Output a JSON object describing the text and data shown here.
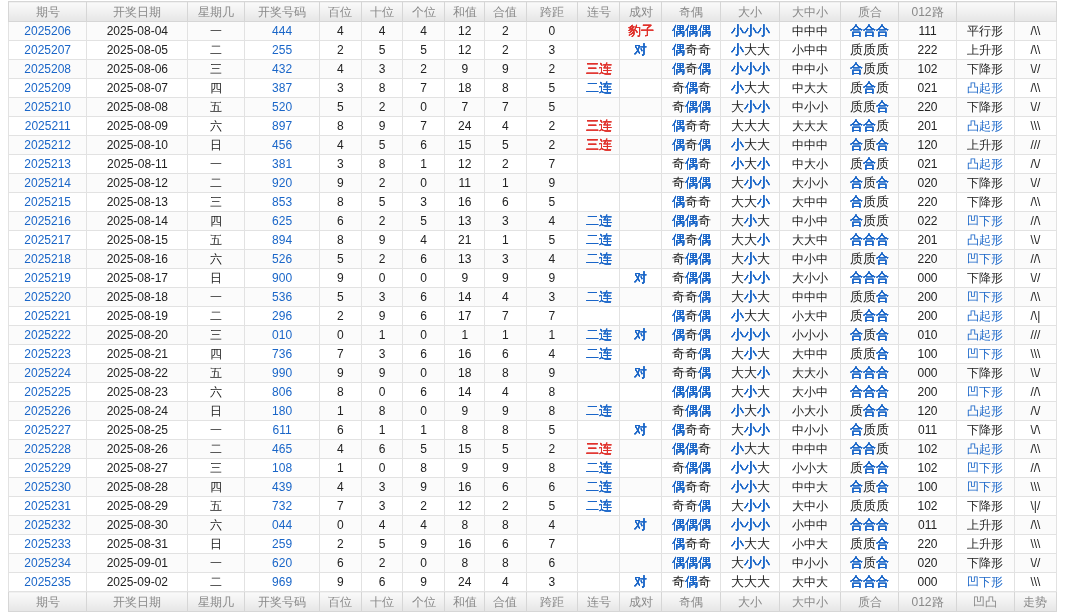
{
  "header_top": [
    "期号",
    "开奖日期",
    "星期几",
    "开奖号码",
    "百位",
    "十位",
    "个位",
    "和值",
    "合值",
    "跨距",
    "连号",
    "成对",
    "奇偶",
    "大小",
    "大中小",
    "质合",
    "012路"
  ],
  "rows": [
    {
      "issue": "2025206",
      "date": "2025-08-04",
      "weekday": "一",
      "number": "444",
      "hundreds": "4",
      "tens": "4",
      "units": "4",
      "sum": "12",
      "sum_tail": "2",
      "span": "0",
      "pair": {
        "text": "豹子",
        "color": "#e0302a"
      },
      "odd_even": "偶偶偶",
      "odd_even_blue": [
        true,
        true,
        true
      ],
      "big_small": "小小小",
      "big_small_blue": [
        true,
        true,
        true
      ],
      "big_mid_small": "中中中",
      "prime_composite": "合合合",
      "prime_composite_blue": [
        true,
        true,
        true
      ],
      "road_012": "111",
      "shape": "平行形",
      "shape_blue": false,
      "trend": "/\\\\"
    },
    {
      "issue": "2025207",
      "date": "2025-08-05",
      "weekday": "二",
      "number": "255",
      "hundreds": "2",
      "tens": "5",
      "units": "5",
      "sum": "12",
      "sum_tail": "2",
      "span": "3",
      "pair": {
        "text": "对",
        "color": "#1a66c8"
      },
      "odd_even": "偶奇奇",
      "odd_even_blue": [
        true,
        false,
        false
      ],
      "big_small": "小大大",
      "big_small_blue": [
        true,
        false,
        false
      ],
      "big_mid_small": "小中中",
      "prime_composite": "质质质",
      "prime_composite_blue": [
        false,
        false,
        false
      ],
      "road_012": "222",
      "shape": "上升形",
      "shape_blue": false,
      "trend": "/\\\\"
    },
    {
      "issue": "2025208",
      "date": "2025-08-06",
      "weekday": "三",
      "number": "432",
      "hundreds": "4",
      "tens": "3",
      "units": "2",
      "sum": "9",
      "sum_tail": "9",
      "span": "2",
      "consecutive": {
        "text": "三连",
        "color": "#e0302a"
      },
      "odd_even": "偶奇偶",
      "odd_even_blue": [
        true,
        false,
        true
      ],
      "big_small": "小小小",
      "big_small_blue": [
        true,
        true,
        true
      ],
      "big_mid_small": "中中小",
      "prime_composite": "合质质",
      "prime_composite_blue": [
        true,
        false,
        false
      ],
      "road_012": "102",
      "shape": "下降形",
      "shape_blue": false,
      "trend": "\\//"
    },
    {
      "issue": "2025209",
      "date": "2025-08-07",
      "weekday": "四",
      "number": "387",
      "hundreds": "3",
      "tens": "8",
      "units": "7",
      "sum": "18",
      "sum_tail": "8",
      "span": "5",
      "consecutive": {
        "text": "二连",
        "color": "#1a66c8"
      },
      "odd_even": "奇偶奇",
      "odd_even_blue": [
        false,
        true,
        false
      ],
      "big_small": "小大大",
      "big_small_blue": [
        true,
        false,
        false
      ],
      "big_mid_small": "中大大",
      "prime_composite": "质合质",
      "prime_composite_blue": [
        false,
        true,
        false
      ],
      "road_012": "021",
      "shape": "凸起形",
      "shape_blue": true,
      "trend": "/\\\\"
    },
    {
      "issue": "2025210",
      "date": "2025-08-08",
      "weekday": "五",
      "number": "520",
      "hundreds": "5",
      "tens": "2",
      "units": "0",
      "sum": "7",
      "sum_tail": "7",
      "span": "5",
      "odd_even": "奇偶偶",
      "odd_even_blue": [
        false,
        true,
        true
      ],
      "big_small": "大小小",
      "big_small_blue": [
        false,
        true,
        true
      ],
      "big_mid_small": "中小小",
      "prime_composite": "质质合",
      "prime_composite_blue": [
        false,
        false,
        true
      ],
      "road_012": "220",
      "shape": "下降形",
      "shape_blue": false,
      "trend": "\\//"
    },
    {
      "issue": "2025211",
      "date": "2025-08-09",
      "weekday": "六",
      "number": "897",
      "hundreds": "8",
      "tens": "9",
      "units": "7",
      "sum": "24",
      "sum_tail": "4",
      "span": "2",
      "consecutive": {
        "text": "三连",
        "color": "#e0302a"
      },
      "odd_even": "偶奇奇",
      "odd_even_blue": [
        true,
        false,
        false
      ],
      "big_small": "大大大",
      "big_small_blue": [
        false,
        false,
        false
      ],
      "big_mid_small": "大大大",
      "prime_composite": "合合质",
      "prime_composite_blue": [
        true,
        true,
        false
      ],
      "road_012": "201",
      "shape": "凸起形",
      "shape_blue": true,
      "trend": "\\\\\\"
    },
    {
      "issue": "2025212",
      "date": "2025-08-10",
      "weekday": "日",
      "number": "456",
      "hundreds": "4",
      "tens": "5",
      "units": "6",
      "sum": "15",
      "sum_tail": "5",
      "span": "2",
      "consecutive": {
        "text": "三连",
        "color": "#e0302a"
      },
      "odd_even": "偶奇偶",
      "odd_even_blue": [
        true,
        false,
        true
      ],
      "big_small": "小大大",
      "big_small_blue": [
        true,
        false,
        false
      ],
      "big_mid_small": "中中中",
      "prime_composite": "合质合",
      "prime_composite_blue": [
        true,
        false,
        true
      ],
      "road_012": "120",
      "shape": "上升形",
      "shape_blue": false,
      "trend": "///"
    },
    {
      "issue": "2025213",
      "date": "2025-08-11",
      "weekday": "一",
      "number": "381",
      "hundreds": "3",
      "tens": "8",
      "units": "1",
      "sum": "12",
      "sum_tail": "2",
      "span": "7",
      "odd_even": "奇偶奇",
      "odd_even_blue": [
        false,
        true,
        false
      ],
      "big_small": "小大小",
      "big_small_blue": [
        true,
        false,
        true
      ],
      "big_mid_small": "中大小",
      "prime_composite": "质合质",
      "prime_composite_blue": [
        false,
        true,
        false
      ],
      "road_012": "021",
      "shape": "凸起形",
      "shape_blue": true,
      "trend": "/\\/"
    },
    {
      "issue": "2025214",
      "date": "2025-08-12",
      "weekday": "二",
      "number": "920",
      "hundreds": "9",
      "tens": "2",
      "units": "0",
      "sum": "11",
      "sum_tail": "1",
      "span": "9",
      "odd_even": "奇偶偶",
      "odd_even_blue": [
        false,
        true,
        true
      ],
      "big_small": "大小小",
      "big_small_blue": [
        false,
        true,
        true
      ],
      "big_mid_small": "大小小",
      "prime_composite": "合质合",
      "prime_composite_blue": [
        true,
        false,
        true
      ],
      "road_012": "020",
      "shape": "下降形",
      "shape_blue": false,
      "trend": "\\//"
    },
    {
      "issue": "2025215",
      "date": "2025-08-13",
      "weekday": "三",
      "number": "853",
      "hundreds": "8",
      "tens": "5",
      "units": "3",
      "sum": "16",
      "sum_tail": "6",
      "span": "5",
      "odd_even": "偶奇奇",
      "odd_even_blue": [
        true,
        false,
        false
      ],
      "big_small": "大大小",
      "big_small_blue": [
        false,
        false,
        true
      ],
      "big_mid_small": "大中中",
      "prime_composite": "合质质",
      "prime_composite_blue": [
        true,
        false,
        false
      ],
      "road_012": "220",
      "shape": "下降形",
      "shape_blue": false,
      "trend": "/\\\\"
    },
    {
      "issue": "2025216",
      "date": "2025-08-14",
      "weekday": "四",
      "number": "625",
      "hundreds": "6",
      "tens": "2",
      "units": "5",
      "sum": "13",
      "sum_tail": "3",
      "span": "4",
      "consecutive": {
        "text": "二连",
        "color": "#1a66c8"
      },
      "odd_even": "偶偶奇",
      "odd_even_blue": [
        true,
        true,
        false
      ],
      "big_small": "大小大",
      "big_small_blue": [
        false,
        true,
        false
      ],
      "big_mid_small": "中小中",
      "prime_composite": "合质质",
      "prime_composite_blue": [
        true,
        false,
        false
      ],
      "road_012": "022",
      "shape": "凹下形",
      "shape_blue": true,
      "trend": "//\\"
    },
    {
      "issue": "2025217",
      "date": "2025-08-15",
      "weekday": "五",
      "number": "894",
      "hundreds": "8",
      "tens": "9",
      "units": "4",
      "sum": "21",
      "sum_tail": "1",
      "span": "5",
      "consecutive": {
        "text": "二连",
        "color": "#1a66c8"
      },
      "odd_even": "偶奇偶",
      "odd_even_blue": [
        true,
        false,
        true
      ],
      "big_small": "大大小",
      "big_small_blue": [
        false,
        false,
        true
      ],
      "big_mid_small": "大大中",
      "prime_composite": "合合合",
      "prime_composite_blue": [
        true,
        true,
        true
      ],
      "road_012": "201",
      "shape": "凸起形",
      "shape_blue": true,
      "trend": "\\\\/"
    },
    {
      "issue": "2025218",
      "date": "2025-08-16",
      "weekday": "六",
      "number": "526",
      "hundreds": "5",
      "tens": "2",
      "units": "6",
      "sum": "13",
      "sum_tail": "3",
      "span": "4",
      "consecutive": {
        "text": "二连",
        "color": "#1a66c8"
      },
      "odd_even": "奇偶偶",
      "odd_even_blue": [
        false,
        true,
        true
      ],
      "big_small": "大小大",
      "big_small_blue": [
        false,
        true,
        false
      ],
      "big_mid_small": "中小中",
      "prime_composite": "质质合",
      "prime_composite_blue": [
        false,
        false,
        true
      ],
      "road_012": "220",
      "shape": "凹下形",
      "shape_blue": true,
      "trend": "//\\"
    },
    {
      "issue": "2025219",
      "date": "2025-08-17",
      "weekday": "日",
      "number": "900",
      "hundreds": "9",
      "tens": "0",
      "units": "0",
      "sum": "9",
      "sum_tail": "9",
      "span": "9",
      "pair": {
        "text": "对",
        "color": "#1a66c8"
      },
      "odd_even": "奇偶偶",
      "odd_even_blue": [
        false,
        true,
        true
      ],
      "big_small": "大小小",
      "big_small_blue": [
        false,
        true,
        true
      ],
      "big_mid_small": "大小小",
      "prime_composite": "合合合",
      "prime_composite_blue": [
        true,
        true,
        true
      ],
      "road_012": "000",
      "shape": "下降形",
      "shape_blue": false,
      "trend": "\\//"
    },
    {
      "issue": "2025220",
      "date": "2025-08-18",
      "weekday": "一",
      "number": "536",
      "hundreds": "5",
      "tens": "3",
      "units": "6",
      "sum": "14",
      "sum_tail": "4",
      "span": "3",
      "consecutive": {
        "text": "二连",
        "color": "#1a66c8"
      },
      "odd_even": "奇奇偶",
      "odd_even_blue": [
        false,
        false,
        true
      ],
      "big_small": "大小大",
      "big_small_blue": [
        false,
        true,
        false
      ],
      "big_mid_small": "中中中",
      "prime_composite": "质质合",
      "prime_composite_blue": [
        false,
        false,
        true
      ],
      "road_012": "200",
      "shape": "凹下形",
      "shape_blue": true,
      "trend": "/\\\\"
    },
    {
      "issue": "2025221",
      "date": "2025-08-19",
      "weekday": "二",
      "number": "296",
      "hundreds": "2",
      "tens": "9",
      "units": "6",
      "sum": "17",
      "sum_tail": "7",
      "span": "7",
      "odd_even": "偶奇偶",
      "odd_even_blue": [
        true,
        false,
        true
      ],
      "big_small": "小大大",
      "big_small_blue": [
        true,
        false,
        false
      ],
      "big_mid_small": "小大中",
      "prime_composite": "质合合",
      "prime_composite_blue": [
        false,
        true,
        true
      ],
      "road_012": "200",
      "shape": "凸起形",
      "shape_blue": true,
      "trend": "/\\|"
    },
    {
      "issue": "2025222",
      "date": "2025-08-20",
      "weekday": "三",
      "number": "010",
      "hundreds": "0",
      "tens": "1",
      "units": "0",
      "sum": "1",
      "sum_tail": "1",
      "span": "1",
      "consecutive": {
        "text": "二连",
        "color": "#1a66c8"
      },
      "pair": {
        "text": "对",
        "color": "#1a66c8"
      },
      "odd_even": "偶奇偶",
      "odd_even_blue": [
        true,
        false,
        true
      ],
      "big_small": "小小小",
      "big_small_blue": [
        true,
        true,
        true
      ],
      "big_mid_small": "小小小",
      "prime_composite": "合质合",
      "prime_composite_blue": [
        true,
        false,
        true
      ],
      "road_012": "010",
      "shape": "凸起形",
      "shape_blue": true,
      "trend": "///"
    },
    {
      "issue": "2025223",
      "date": "2025-08-21",
      "weekday": "四",
      "number": "736",
      "hundreds": "7",
      "tens": "3",
      "units": "6",
      "sum": "16",
      "sum_tail": "6",
      "span": "4",
      "consecutive": {
        "text": "二连",
        "color": "#1a66c8"
      },
      "odd_even": "奇奇偶",
      "odd_even_blue": [
        false,
        false,
        true
      ],
      "big_small": "大小大",
      "big_small_blue": [
        false,
        true,
        false
      ],
      "big_mid_small": "大中中",
      "prime_composite": "质质合",
      "prime_composite_blue": [
        false,
        false,
        true
      ],
      "road_012": "100",
      "shape": "凹下形",
      "shape_blue": true,
      "trend": "\\\\\\"
    },
    {
      "issue": "2025224",
      "date": "2025-08-22",
      "weekday": "五",
      "number": "990",
      "hundreds": "9",
      "tens": "9",
      "units": "0",
      "sum": "18",
      "sum_tail": "8",
      "span": "9",
      "pair": {
        "text": "对",
        "color": "#1a66c8"
      },
      "odd_even": "奇奇偶",
      "odd_even_blue": [
        false,
        false,
        true
      ],
      "big_small": "大大小",
      "big_small_blue": [
        false,
        false,
        true
      ],
      "big_mid_small": "大大小",
      "prime_composite": "合合合",
      "prime_composite_blue": [
        true,
        true,
        true
      ],
      "road_012": "000",
      "shape": "下降形",
      "shape_blue": false,
      "trend": "\\\\/"
    },
    {
      "issue": "2025225",
      "date": "2025-08-23",
      "weekday": "六",
      "number": "806",
      "hundreds": "8",
      "tens": "0",
      "units": "6",
      "sum": "14",
      "sum_tail": "4",
      "span": "8",
      "odd_even": "偶偶偶",
      "odd_even_blue": [
        true,
        true,
        true
      ],
      "big_small": "大小大",
      "big_small_blue": [
        false,
        true,
        false
      ],
      "big_mid_small": "大小中",
      "prime_composite": "合合合",
      "prime_composite_blue": [
        true,
        true,
        true
      ],
      "road_012": "200",
      "shape": "凹下形",
      "shape_blue": true,
      "trend": "//\\"
    },
    {
      "issue": "2025226",
      "date": "2025-08-24",
      "weekday": "日",
      "number": "180",
      "hundreds": "1",
      "tens": "8",
      "units": "0",
      "sum": "9",
      "sum_tail": "9",
      "span": "8",
      "consecutive": {
        "text": "二连",
        "color": "#1a66c8"
      },
      "odd_even": "奇偶偶",
      "odd_even_blue": [
        false,
        true,
        true
      ],
      "big_small": "小大小",
      "big_small_blue": [
        true,
        false,
        true
      ],
      "big_mid_small": "小大小",
      "prime_composite": "质合合",
      "prime_composite_blue": [
        false,
        true,
        true
      ],
      "road_012": "120",
      "shape": "凸起形",
      "shape_blue": true,
      "trend": "/\\/"
    },
    {
      "issue": "2025227",
      "date": "2025-08-25",
      "weekday": "一",
      "number": "611",
      "hundreds": "6",
      "tens": "1",
      "units": "1",
      "sum": "8",
      "sum_tail": "8",
      "span": "5",
      "pair": {
        "text": "对",
        "color": "#1a66c8"
      },
      "odd_even": "偶奇奇",
      "odd_even_blue": [
        true,
        false,
        false
      ],
      "big_small": "大小小",
      "big_small_blue": [
        false,
        true,
        true
      ],
      "big_mid_small": "中小小",
      "prime_composite": "合质质",
      "prime_composite_blue": [
        true,
        false,
        false
      ],
      "road_012": "011",
      "shape": "下降形",
      "shape_blue": false,
      "trend": "\\/\\"
    },
    {
      "issue": "2025228",
      "date": "2025-08-26",
      "weekday": "二",
      "number": "465",
      "hundreds": "4",
      "tens": "6",
      "units": "5",
      "sum": "15",
      "sum_tail": "5",
      "span": "2",
      "consecutive": {
        "text": "三连",
        "color": "#e0302a"
      },
      "odd_even": "偶偶奇",
      "odd_even_blue": [
        true,
        true,
        false
      ],
      "big_small": "小大大",
      "big_small_blue": [
        true,
        false,
        false
      ],
      "big_mid_small": "中中中",
      "prime_composite": "合合质",
      "prime_composite_blue": [
        true,
        true,
        false
      ],
      "road_012": "102",
      "shape": "凸起形",
      "shape_blue": true,
      "trend": "/\\\\"
    },
    {
      "issue": "2025229",
      "date": "2025-08-27",
      "weekday": "三",
      "number": "108",
      "hundreds": "1",
      "tens": "0",
      "units": "8",
      "sum": "9",
      "sum_tail": "9",
      "span": "8",
      "consecutive": {
        "text": "二连",
        "color": "#1a66c8"
      },
      "odd_even": "奇偶偶",
      "odd_even_blue": [
        false,
        true,
        true
      ],
      "big_small": "小小大",
      "big_small_blue": [
        true,
        true,
        false
      ],
      "big_mid_small": "小小大",
      "prime_composite": "质合合",
      "prime_composite_blue": [
        false,
        true,
        true
      ],
      "road_012": "102",
      "shape": "凹下形",
      "shape_blue": true,
      "trend": "//\\"
    },
    {
      "issue": "2025230",
      "date": "2025-08-28",
      "weekday": "四",
      "number": "439",
      "hundreds": "4",
      "tens": "3",
      "units": "9",
      "sum": "16",
      "sum_tail": "6",
      "span": "6",
      "consecutive": {
        "text": "二连",
        "color": "#1a66c8"
      },
      "odd_even": "偶奇奇",
      "odd_even_blue": [
        true,
        false,
        false
      ],
      "big_small": "小小大",
      "big_small_blue": [
        true,
        true,
        false
      ],
      "big_mid_small": "中中大",
      "prime_composite": "合质合",
      "prime_composite_blue": [
        true,
        false,
        true
      ],
      "road_012": "100",
      "shape": "凹下形",
      "shape_blue": true,
      "trend": "\\\\\\"
    },
    {
      "issue": "2025231",
      "date": "2025-08-29",
      "weekday": "五",
      "number": "732",
      "hundreds": "7",
      "tens": "3",
      "units": "2",
      "sum": "12",
      "sum_tail": "2",
      "span": "5",
      "consecutive": {
        "text": "二连",
        "color": "#1a66c8"
      },
      "odd_even": "奇奇偶",
      "odd_even_blue": [
        false,
        false,
        true
      ],
      "big_small": "大小小",
      "big_small_blue": [
        false,
        true,
        true
      ],
      "big_mid_small": "大中小",
      "prime_composite": "质质质",
      "prime_composite_blue": [
        false,
        false,
        false
      ],
      "road_012": "102",
      "shape": "下降形",
      "shape_blue": false,
      "trend": "\\|/"
    },
    {
      "issue": "2025232",
      "date": "2025-08-30",
      "weekday": "六",
      "number": "044",
      "hundreds": "0",
      "tens": "4",
      "units": "4",
      "sum": "8",
      "sum_tail": "8",
      "span": "4",
      "pair": {
        "text": "对",
        "color": "#1a66c8"
      },
      "odd_even": "偶偶偶",
      "odd_even_blue": [
        true,
        true,
        true
      ],
      "big_small": "小小小",
      "big_small_blue": [
        true,
        true,
        true
      ],
      "big_mid_small": "小中中",
      "prime_composite": "合合合",
      "prime_composite_blue": [
        true,
        true,
        true
      ],
      "road_012": "011",
      "shape": "上升形",
      "shape_blue": false,
      "trend": "/\\\\"
    },
    {
      "issue": "2025233",
      "date": "2025-08-31",
      "weekday": "日",
      "number": "259",
      "hundreds": "2",
      "tens": "5",
      "units": "9",
      "sum": "16",
      "sum_tail": "6",
      "span": "7",
      "odd_even": "偶奇奇",
      "odd_even_blue": [
        true,
        false,
        false
      ],
      "big_small": "小大大",
      "big_small_blue": [
        true,
        false,
        false
      ],
      "big_mid_small": "小中大",
      "prime_composite": "质质合",
      "prime_composite_blue": [
        false,
        false,
        true
      ],
      "road_012": "220",
      "shape": "上升形",
      "shape_blue": false,
      "trend": "\\\\\\"
    },
    {
      "issue": "2025234",
      "date": "2025-09-01",
      "weekday": "一",
      "number": "620",
      "hundreds": "6",
      "tens": "2",
      "units": "0",
      "sum": "8",
      "sum_tail": "8",
      "span": "6",
      "odd_even": "偶偶偶",
      "odd_even_blue": [
        true,
        true,
        true
      ],
      "big_small": "大小小",
      "big_small_blue": [
        false,
        true,
        true
      ],
      "big_mid_small": "中小小",
      "prime_composite": "合质合",
      "prime_composite_blue": [
        true,
        false,
        true
      ],
      "road_012": "020",
      "shape": "下降形",
      "shape_blue": false,
      "trend": "\\//"
    },
    {
      "issue": "2025235",
      "date": "2025-09-02",
      "weekday": "二",
      "number": "969",
      "hundreds": "9",
      "tens": "6",
      "units": "9",
      "sum": "24",
      "sum_tail": "4",
      "span": "3",
      "pair": {
        "text": "对",
        "color": "#1a66c8"
      },
      "odd_even": "奇偶奇",
      "odd_even_blue": [
        false,
        true,
        false
      ],
      "big_small": "大大大",
      "big_small_blue": [
        false,
        false,
        false
      ],
      "big_mid_small": "大中大",
      "prime_composite": "合合合",
      "prime_composite_blue": [
        true,
        true,
        true
      ],
      "road_012": "000",
      "shape": "凹下形",
      "shape_blue": true,
      "trend": "\\\\\\"
    }
  ],
  "header_bottom": [
    "期号",
    "开奖日期",
    "星期几",
    "开奖号码",
    "百位",
    "十位",
    "个位",
    "和值",
    "合值",
    "跨距",
    "连号",
    "成对",
    "奇偶",
    "大小",
    "大中小",
    "质合",
    "012路",
    "凹凸",
    "走势"
  ]
}
